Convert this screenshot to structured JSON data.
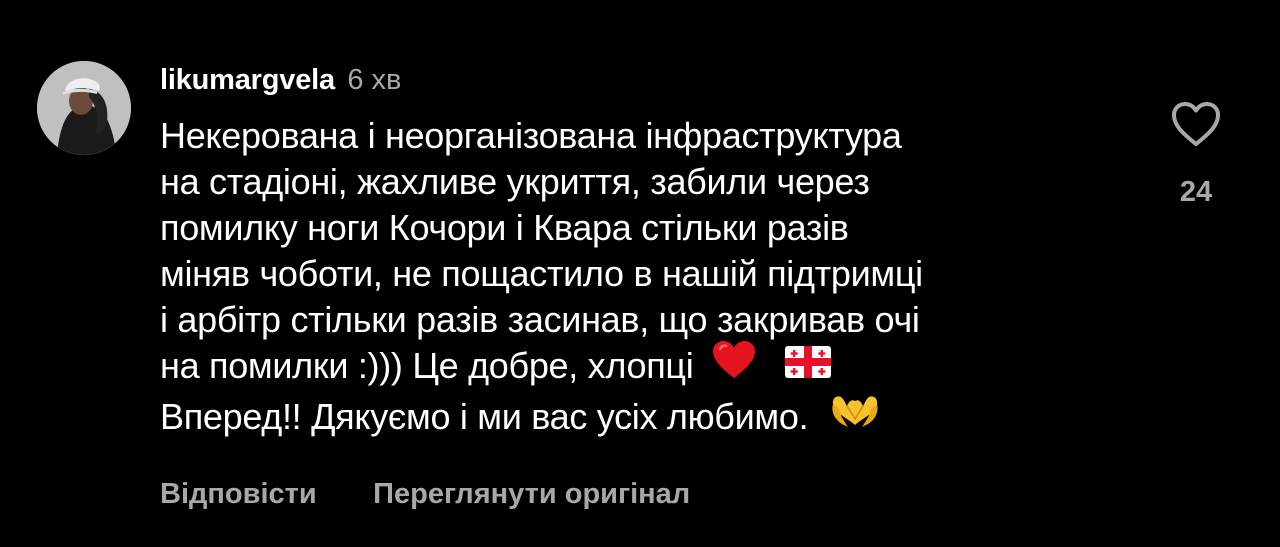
{
  "comment": {
    "username": "likumargvela",
    "timestamp": "6 хв",
    "avatar_icon": "avatar-photo",
    "text_lines": [
      "Некерована і неорганізована інфраструктура",
      "на стадіоні, жахливе укриття, забили через",
      "помилку ноги Кочори і Квара стільки разів",
      "міняв чоботи, не пощастило в нашій підтримці",
      "і арбітр стільки разів засинав, що закривав очі",
      "на помилки :))) Це добре, хлопці",
      "Вперед!! Дякуємо і ми вас усіх любимо."
    ],
    "emojis": {
      "heart": "red-heart-emoji",
      "flag": "georgia-flag-emoji",
      "hands": "heart-hands-emoji"
    },
    "like_icon": "heart-outline-icon",
    "like_count": "24",
    "actions": {
      "reply": "Відповісти",
      "see_original": "Переглянути оригінал"
    }
  },
  "colors": {
    "background": "#000000",
    "primary_text": "#ffffff",
    "secondary_text": "#a8a8a8",
    "heart_emoji": "#e3141d",
    "hands_emoji": "#f7c32e"
  }
}
